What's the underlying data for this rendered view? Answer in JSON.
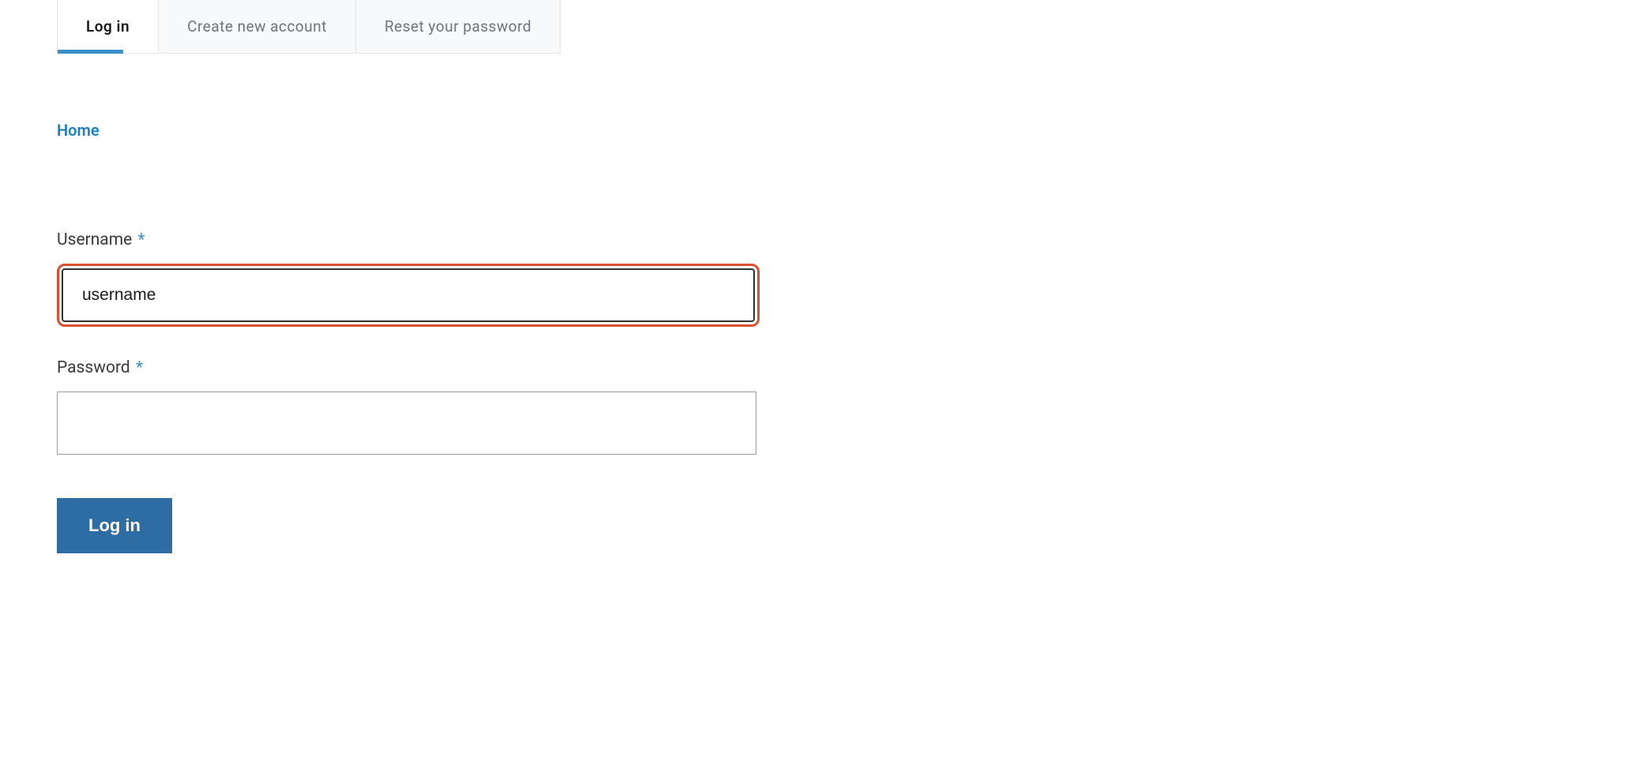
{
  "tabs": {
    "login": "Log in",
    "create": "Create new account",
    "reset": "Reset your password"
  },
  "breadcrumb": {
    "home": "Home"
  },
  "form": {
    "username_label": "Username",
    "username_value": "username",
    "password_label": "Password",
    "password_value": "",
    "required_marker": "*",
    "submit_label": "Log in"
  }
}
